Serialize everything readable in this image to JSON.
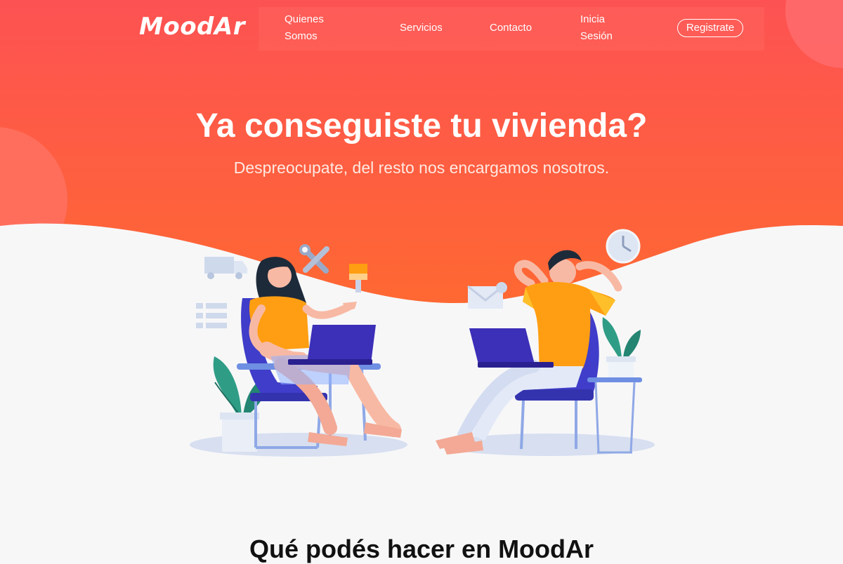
{
  "brand": {
    "logo": "MoodAr"
  },
  "nav": {
    "quienes_somos": "Quienes Somos",
    "servicios": "Servicios",
    "contacto": "Contacto",
    "inicia_sesion": "Inicia Sesión",
    "registrate": "Registrate"
  },
  "hero": {
    "title": "Ya conseguiste tu vivienda?",
    "subtitle": "Despreocupate, del resto nos encargamos nosotros."
  },
  "features": {
    "title": "Qué podés hacer en MoodAr"
  },
  "colors": {
    "gradient_top": "#fd5253",
    "gradient_bottom": "#ff6a2f",
    "page_bg": "#f7f7f8",
    "accent_orange": "#ff9e12",
    "chair_blue": "#3f3dc9",
    "laptop_purple": "#3c2fb8",
    "plant_green": "#2f9d86"
  },
  "icons": [
    "truck-icon",
    "wrench-screwdriver-icon",
    "paint-brush-icon",
    "list-icon",
    "clock-icon",
    "email-icon"
  ]
}
